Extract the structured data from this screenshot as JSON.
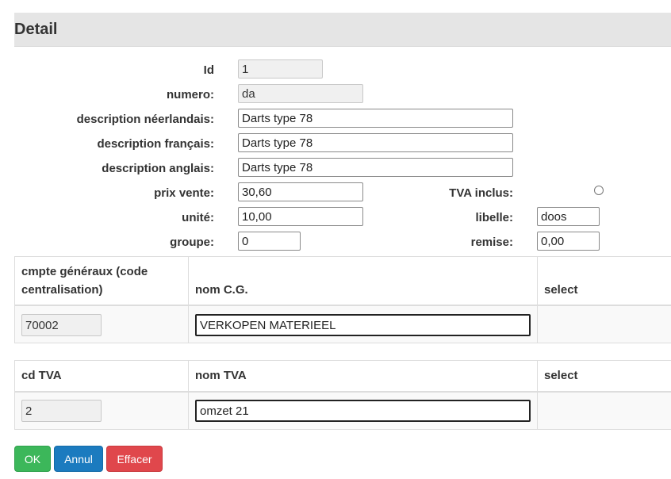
{
  "header": {
    "title": "Detail"
  },
  "form": {
    "id": {
      "label": "Id",
      "value": "1"
    },
    "numero": {
      "label": "numero:",
      "value": "da"
    },
    "desc_nl": {
      "label": "description néerlandais:",
      "value": "Darts type 78"
    },
    "desc_fr": {
      "label": "description français:",
      "value": "Darts type 78"
    },
    "desc_en": {
      "label": "description anglais:",
      "value": "Darts type 78"
    },
    "prix": {
      "label": "prix vente:",
      "value": "30,60"
    },
    "tva_inclus": {
      "label": "TVA inclus:",
      "checked": false
    },
    "unite": {
      "label": "unité:",
      "value": "10,00"
    },
    "libelle": {
      "label": "libelle:",
      "value": "doos"
    },
    "groupe": {
      "label": "groupe:",
      "value": "0"
    },
    "remise": {
      "label": "remise:",
      "value": "0,00"
    }
  },
  "table_cg": {
    "headers": [
      "cmpte généraux (code centralisation)",
      "nom C.G.",
      "select"
    ],
    "row": {
      "code": "70002",
      "name": "VERKOPEN MATERIEEL"
    }
  },
  "table_tva": {
    "headers": [
      "cd TVA",
      "nom TVA",
      "select"
    ],
    "row": {
      "code": "2",
      "name": "omzet 21"
    }
  },
  "buttons": {
    "ok": "OK",
    "annul": "Annul",
    "effacer": "Effacer"
  }
}
